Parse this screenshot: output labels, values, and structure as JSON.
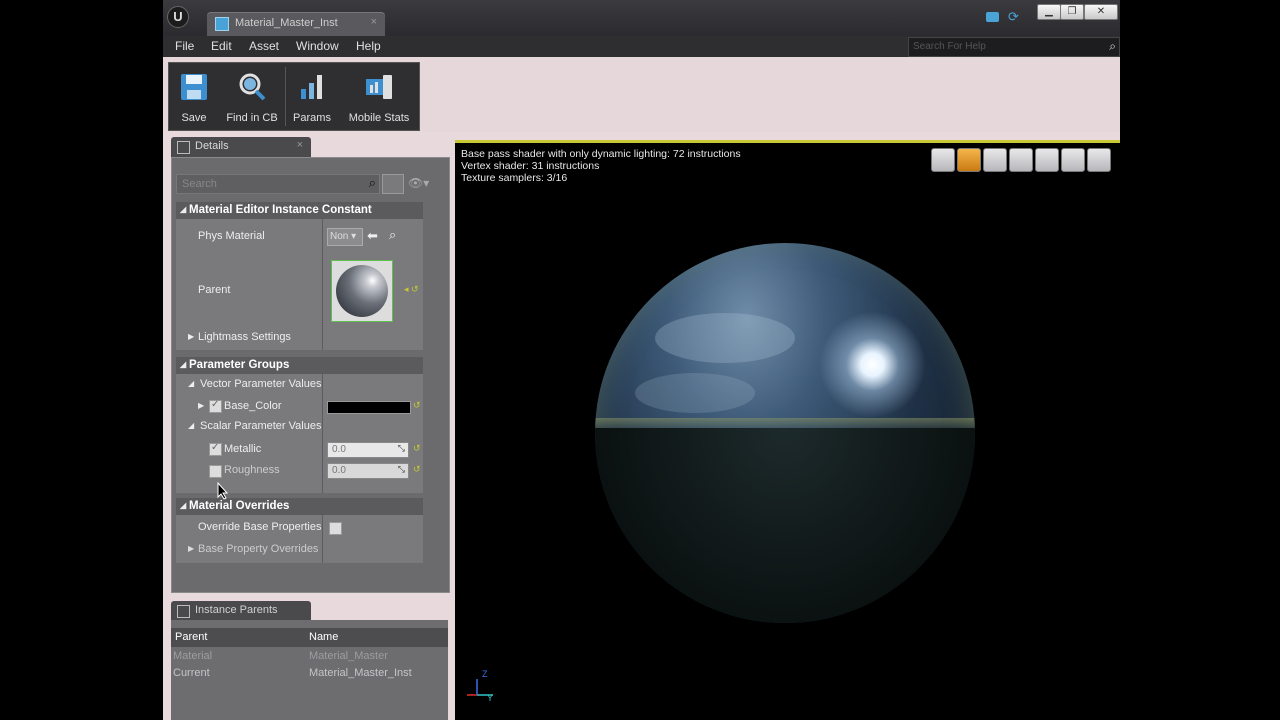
{
  "window": {
    "tab_title": "Material_Master_Inst",
    "tab_close": "×",
    "buttons": {
      "minimize": "▁",
      "restore": "❐",
      "close": "✕"
    }
  },
  "menu": {
    "items": [
      "File",
      "Edit",
      "Asset",
      "Window",
      "Help"
    ],
    "search_placeholder": "Search For Help"
  },
  "toolbar": {
    "buttons": [
      {
        "label": "Save",
        "icon": "save-icon"
      },
      {
        "label": "Find in CB",
        "icon": "find-in-cb-icon"
      },
      {
        "label": "Params",
        "icon": "params-icon"
      },
      {
        "label": "Mobile Stats",
        "icon": "mobile-stats-icon"
      }
    ]
  },
  "details": {
    "tab_label": "Details",
    "search_placeholder": "Search",
    "sections": {
      "constant": {
        "title": "Material Editor Instance Constant",
        "phys_material_label": "Phys Material",
        "phys_material_value": "Non",
        "parent_label": "Parent",
        "lightmass_label": "Lightmass Settings"
      },
      "param_groups": {
        "title": "Parameter Groups",
        "vector_label": "Vector Parameter Values",
        "base_color_label": "Base_Color",
        "scalar_label": "Scalar Parameter Values",
        "metallic_label": "Metallic",
        "metallic_value": "0.0",
        "roughness_label": "Roughness",
        "roughness_value": "0.0"
      },
      "overrides": {
        "title": "Material Overrides",
        "override_label": "Override Base Properties",
        "base_property_label": "Base Property Overrides"
      }
    }
  },
  "instance_parents": {
    "tab_label": "Instance Parents",
    "columns": [
      "Parent",
      "Name"
    ],
    "rows": [
      {
        "parent": "Material",
        "name": "Material_Master"
      },
      {
        "parent": "Current",
        "name": "Material_Master_Inst"
      }
    ]
  },
  "viewport": {
    "info": [
      "Base pass shader with only dynamic lighting: 72 instructions",
      "Vertex shader: 31 instructions",
      "Texture samplers: 3/16"
    ],
    "axis": {
      "z": "Z",
      "y": "Y"
    }
  },
  "colors": {
    "accent": "#c8c832",
    "panel": "#7a7a7d",
    "section_header": "#5b5b5e",
    "base_color_swatch": "#000000"
  }
}
